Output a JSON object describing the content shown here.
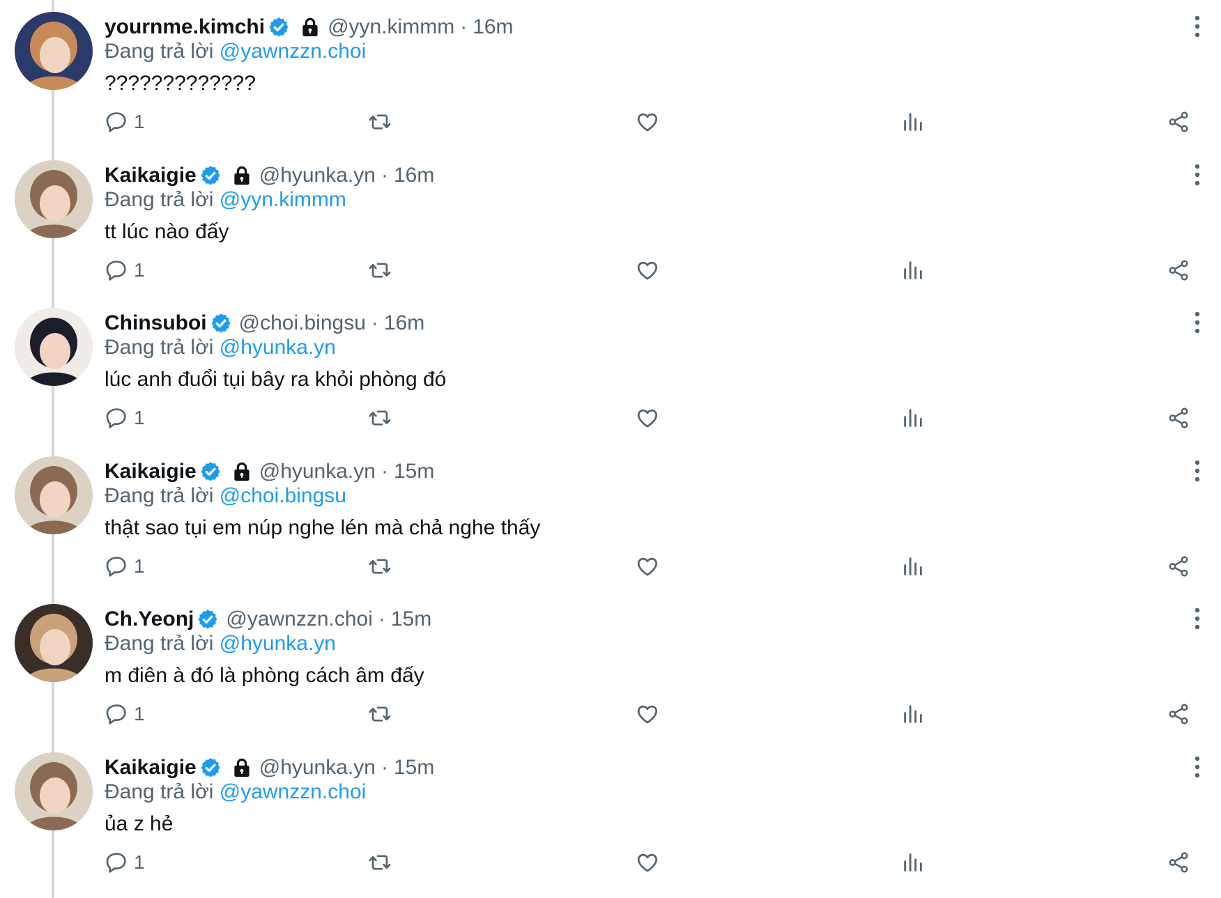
{
  "colors": {
    "accent": "#1d9bf0",
    "secondary_text": "#536471",
    "primary_text": "#0f1419",
    "thread_line": "#cfd9de"
  },
  "icons": {
    "verified": "verified-badge-icon",
    "lock": "protected-lock-icon",
    "more": "more-vertical-icon",
    "reply": "reply-bubble-icon",
    "retweet": "retweet-icon",
    "like": "heart-icon",
    "views": "views-bar-chart-icon",
    "share": "share-icon"
  },
  "tweets": [
    {
      "name": "yournme.kimchi",
      "handle": "@yyn.kimmm",
      "sep": "·",
      "time": "16m",
      "reply_prefix": "Đang trả lời ",
      "reply_to": "@yawnzzn.choi",
      "text": "?????????????",
      "reply_count": "1",
      "locked": true,
      "avatar_colors": [
        "#2a3a6b",
        "#c98a5a"
      ]
    },
    {
      "name": "Kaikaigie",
      "handle": "@hyunka.yn",
      "sep": "·",
      "time": "16m",
      "reply_prefix": "Đang trả lời ",
      "reply_to": "@yyn.kimmm",
      "text": "tt lúc nào đấy",
      "reply_count": "1",
      "locked": true,
      "avatar_colors": [
        "#dcd2c4",
        "#8a6a52"
      ]
    },
    {
      "name": "Chinsuboi",
      "handle": "@choi.bingsu",
      "sep": "·",
      "time": "16m",
      "reply_prefix": "Đang trả lời ",
      "reply_to": "@hyunka.yn",
      "text": "lúc anh đuổi tụi bây ra khỏi phòng đó",
      "reply_count": "1",
      "locked": false,
      "avatar_colors": [
        "#f1ece8",
        "#1d1c2a"
      ]
    },
    {
      "name": "Kaikaigie",
      "handle": "@hyunka.yn",
      "sep": "·",
      "time": "15m",
      "reply_prefix": "Đang trả lời ",
      "reply_to": "@choi.bingsu",
      "text": "thật sao tụi em núp nghe lén mà chả nghe thấy",
      "reply_count": "1",
      "locked": true,
      "avatar_colors": [
        "#dcd2c4",
        "#8a6a52"
      ]
    },
    {
      "name": "Ch.Yeonj",
      "handle": "@yawnzzn.choi",
      "sep": "·",
      "time": "15m",
      "reply_prefix": "Đang trả lời ",
      "reply_to": "@hyunka.yn",
      "text": "m điên à đó là phòng cách âm đấy",
      "reply_count": "1",
      "locked": false,
      "avatar_colors": [
        "#3a2e28",
        "#c9a27a"
      ]
    },
    {
      "name": "Kaikaigie",
      "handle": "@hyunka.yn",
      "sep": "·",
      "time": "15m",
      "reply_prefix": "Đang trả lời ",
      "reply_to": "@yawnzzn.choi",
      "text": "ủa z hẻ",
      "reply_count": "1",
      "locked": true,
      "avatar_colors": [
        "#dcd2c4",
        "#8a6a52"
      ]
    }
  ]
}
